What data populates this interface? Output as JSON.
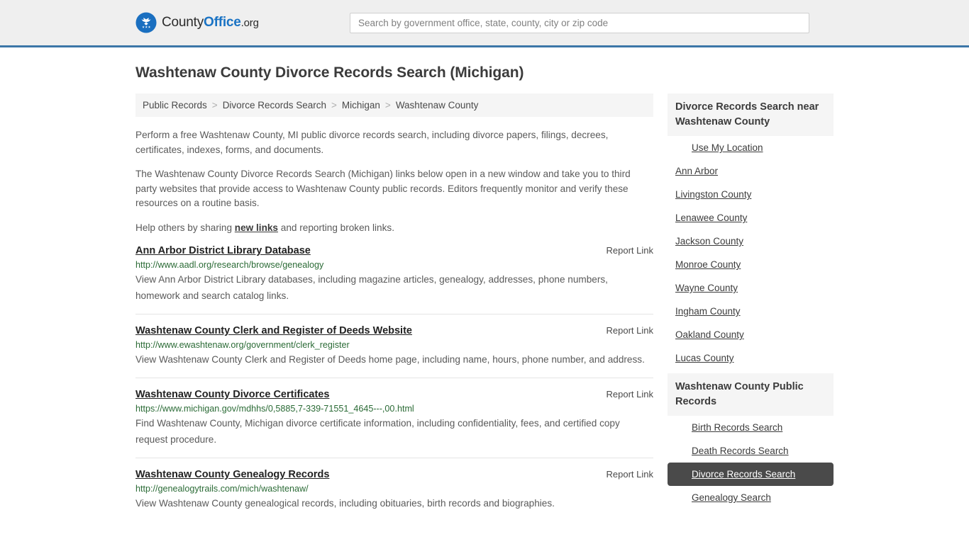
{
  "header": {
    "brand": {
      "logo_icon": "eagle-shield-icon",
      "text_county": "County",
      "text_office": "Office",
      "text_tld": ".org"
    },
    "search": {
      "placeholder": "Search by government office, state, county, city or zip code",
      "value": ""
    }
  },
  "main": {
    "page_title": "Washtenaw County Divorce Records Search (Michigan)",
    "breadcrumb": [
      "Public Records",
      "Divorce Records Search",
      "Michigan",
      "Washtenaw County"
    ],
    "breadcrumb_separator": ">",
    "intro": {
      "p1": "Perform a free Washtenaw County, MI public divorce records search, including divorce papers, filings, decrees, certificates, indexes, forms, and documents.",
      "p2": "The Washtenaw County Divorce Records Search (Michigan) links below open in a new window and take you to third party websites that provide access to Washtenaw County public records. Editors frequently monitor and verify these resources on a routine basis.",
      "p3_before": "Help others by sharing ",
      "p3_link": "new links",
      "p3_after": " and reporting broken links."
    },
    "report_link_label": "Report Link",
    "results": [
      {
        "title": "Ann Arbor District Library Database",
        "url": "http://www.aadl.org/research/browse/genealogy",
        "description": "View Ann Arbor District Library databases, including magazine articles, genealogy, addresses, phone numbers, homework and search catalog links."
      },
      {
        "title": "Washtenaw County Clerk and Register of Deeds Website",
        "url": "http://www.ewashtenaw.org/government/clerk_register",
        "description": "View Washtenaw County Clerk and Register of Deeds home page, including name, hours, phone number, and address."
      },
      {
        "title": "Washtenaw County Divorce Certificates",
        "url": "https://www.michigan.gov/mdhhs/0,5885,7-339-71551_4645---,00.html",
        "description": "Find Washtenaw County, Michigan divorce certificate information, including confidentiality, fees, and certified copy request procedure."
      },
      {
        "title": "Washtenaw County Genealogy Records",
        "url": "http://genealogytrails.com/mich/washtenaw/",
        "description": "View Washtenaw County genealogical records, including obituaries, birth records and biographies."
      }
    ]
  },
  "sidebar": {
    "nearby": {
      "heading": "Divorce Records Search near Washtenaw County",
      "use_my_location": "Use My Location",
      "items": [
        "Ann Arbor",
        "Livingston County",
        "Lenawee County",
        "Jackson County",
        "Monroe County",
        "Wayne County",
        "Ingham County",
        "Oakland County",
        "Lucas County"
      ]
    },
    "public_records": {
      "heading": "Washtenaw County Public Records",
      "items": [
        {
          "label": "Birth Records Search",
          "active": false
        },
        {
          "label": "Death Records Search",
          "active": false
        },
        {
          "label": "Divorce Records Search",
          "active": true
        },
        {
          "label": "Genealogy Search",
          "active": false
        }
      ]
    }
  },
  "colors": {
    "header_bg": "#efefef",
    "header_border": "#3c76a8",
    "brand_blue": "#1a73c4",
    "url_green": "#2b6b36",
    "active_bg": "#4a4a4a",
    "panel_bg": "#f5f5f5"
  }
}
